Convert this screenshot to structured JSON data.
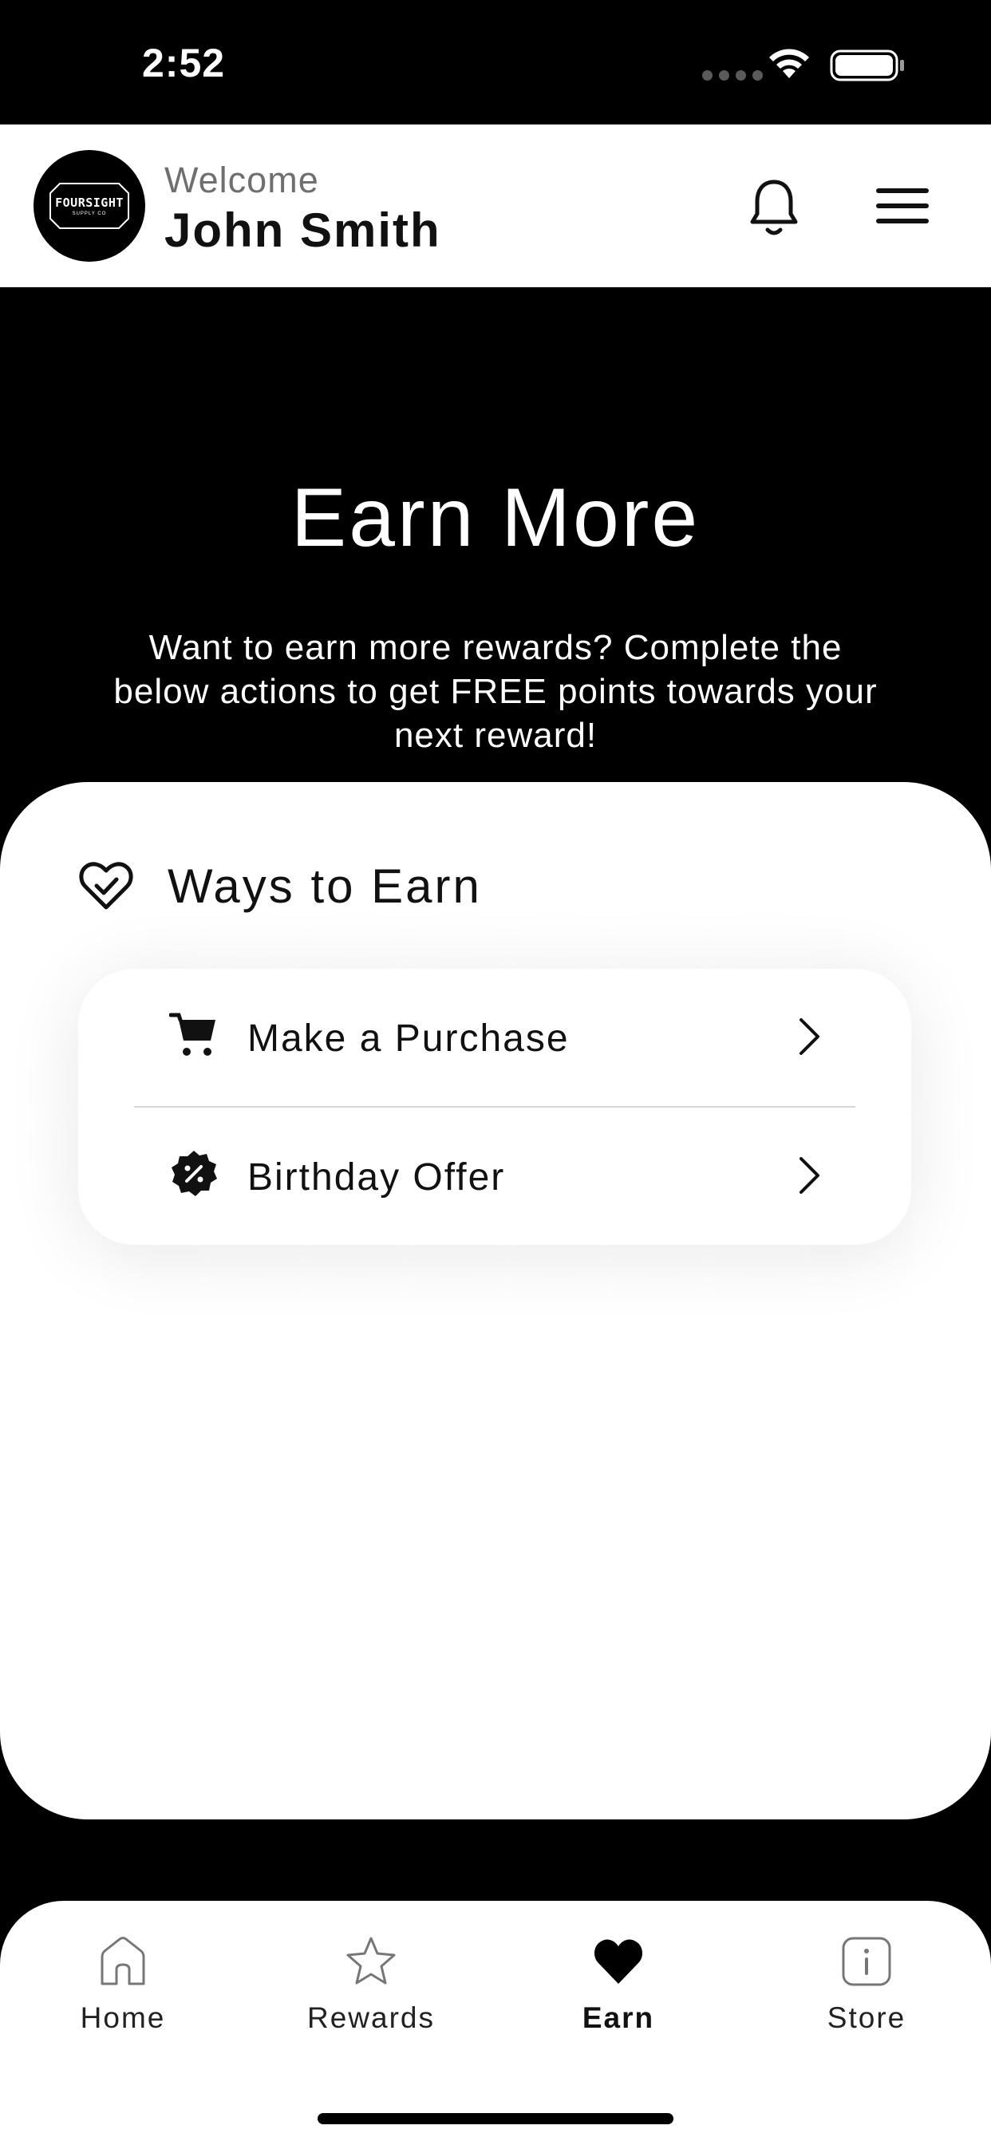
{
  "status_bar": {
    "time": "2:52"
  },
  "header": {
    "logo_text": "FOURSIGHT",
    "logo_subtext": "SUPPLY CO",
    "welcome_label": "Welcome",
    "user_name": "John Smith"
  },
  "hero": {
    "title": "Earn More",
    "description": "Want to earn more rewards? Complete the below actions to get FREE points towards your next reward!"
  },
  "ways_to_earn": {
    "title": "Ways to Earn",
    "icon": "heart-check-icon",
    "items": [
      {
        "label": "Make a Purchase",
        "icon": "cart-icon"
      },
      {
        "label": "Birthday Offer",
        "icon": "discount-badge-icon"
      }
    ]
  },
  "tabbar": {
    "active": "Earn",
    "tabs": [
      {
        "label": "Home",
        "icon": "home-icon"
      },
      {
        "label": "Rewards",
        "icon": "star-icon"
      },
      {
        "label": "Earn",
        "icon": "heart-icon"
      },
      {
        "label": "Store",
        "icon": "info-icon"
      }
    ]
  },
  "colors": {
    "background": "#000000",
    "surface": "#ffffff",
    "text": "#111111",
    "muted": "#6f6f6f"
  }
}
